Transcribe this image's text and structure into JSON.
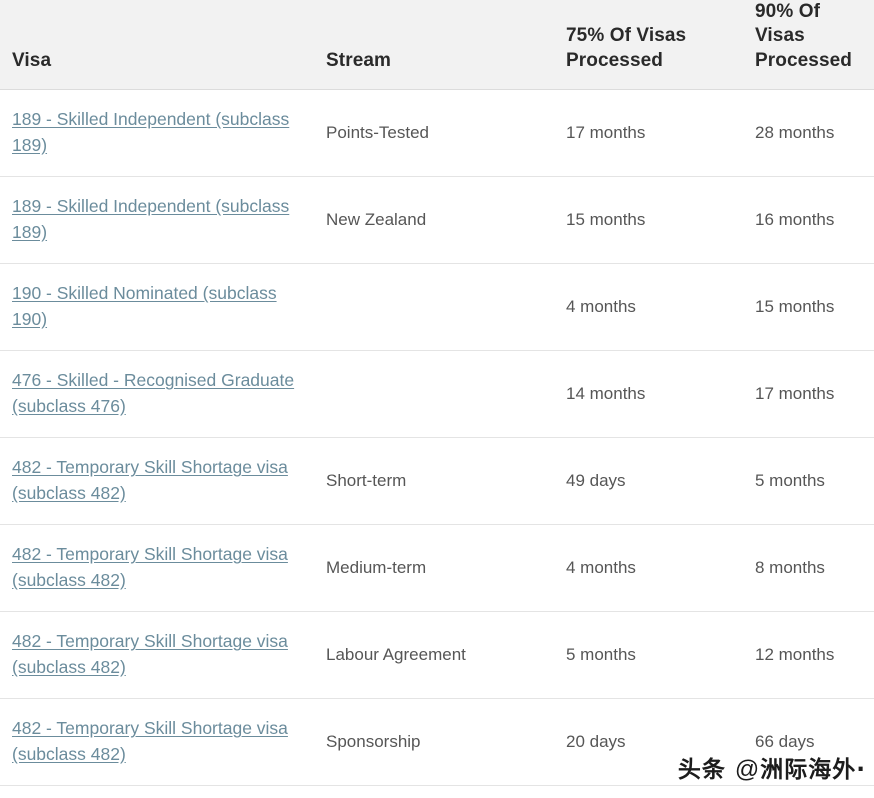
{
  "table": {
    "columns": [
      {
        "key": "visa",
        "label": "Visa"
      },
      {
        "key": "stream",
        "label": "Stream"
      },
      {
        "key": "p75",
        "label": "75% Of Visas Processed"
      },
      {
        "key": "p90",
        "label": "90% Of Visas Processed"
      }
    ],
    "header": {
      "visa": "Visa",
      "stream": "Stream",
      "p75_line1": "75% Of Visas",
      "p75_line2": "Processed",
      "p90_line1": "90% Of Visas",
      "p90_line2": "Processed"
    },
    "rows": [
      {
        "visa": "189 - Skilled Independent (subclass 189)",
        "stream": "Points-Tested",
        "p75": "17 months",
        "p90": "28 months"
      },
      {
        "visa": "189 - Skilled Independent (subclass 189)",
        "stream": "New Zealand",
        "p75": "15 months",
        "p90": "16 months"
      },
      {
        "visa": "190 - Skilled Nominated (subclass 190)",
        "stream": "",
        "p75": "4 months",
        "p90": "15 months"
      },
      {
        "visa": "476 - Skilled - Recognised Graduate (subclass 476)",
        "stream": "",
        "p75": "14 months",
        "p90": "17 months"
      },
      {
        "visa": "482 - Temporary Skill Shortage visa (subclass 482)",
        "stream": "Short-term",
        "p75": "49 days",
        "p90": "5 months"
      },
      {
        "visa": "482 - Temporary Skill Shortage visa (subclass 482)",
        "stream": "Medium-term",
        "p75": "4 months",
        "p90": "8 months"
      },
      {
        "visa": "482 - Temporary Skill Shortage visa (subclass 482)",
        "stream": "Labour Agreement",
        "p75": "5 months",
        "p90": "12 months"
      },
      {
        "visa": "482 - Temporary Skill Shortage visa (subclass 482)",
        "stream": "Sponsorship",
        "p75": "20 days",
        "p90": "66 days"
      }
    ]
  },
  "watermark": {
    "brand": "头条",
    "at": "@",
    "account": "洲际海外·"
  },
  "colors": {
    "link": "#6b8c9c",
    "header_bg": "#f2f2f2",
    "header_text": "#2a2a2a",
    "body_text": "#565656",
    "row_border": "#e4e4e4"
  }
}
